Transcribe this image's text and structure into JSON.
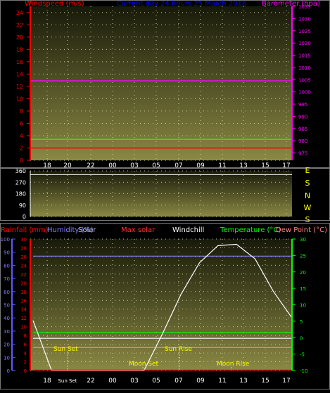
{
  "top": {
    "left_label": "Windspeed (m/s)",
    "center_label": "Current day 24 hours 25 March 2018",
    "right_label": "Barometer (hpa)",
    "colors": {
      "left": "#ff0000",
      "center": "#0000ff",
      "right": "#ff00ff"
    }
  },
  "middle": {
    "compass_labels": [
      "E",
      "S",
      "N",
      "W",
      "S"
    ]
  },
  "bottom": {
    "labels": {
      "rainfall": "Rainfall (mm)",
      "humidity": "Humidity (%)",
      "solar": "Solar",
      "max_solar": "Max solar",
      "windchill": "Windchill",
      "temperature": "Temperature (°C)",
      "dew_point": "Dew Point (°C)"
    },
    "annotations": {
      "sun_set": "Sun Set",
      "sun_rise": "Sun Rise",
      "moon_set": "Moon Set",
      "moon_rise": "Moon Rise"
    }
  },
  "chart_data": [
    {
      "type": "line",
      "title": "Current day 24 hours 25 March 2018",
      "x_tick_labels": [
        "18",
        "20",
        "22",
        "00",
        "03",
        "05",
        "07",
        "09",
        "11",
        "13",
        "15",
        "17"
      ],
      "left_axis": {
        "label": "Windspeed (m/s)",
        "ylim": [
          0,
          25
        ],
        "ticks": [
          0,
          2,
          4,
          6,
          8,
          10,
          12,
          14,
          16,
          18,
          20,
          22,
          24
        ]
      },
      "right_axis": {
        "label": "Barometer (hpa)",
        "ylim": [
          972,
          1035
        ],
        "ticks": [
          975,
          980,
          985,
          990,
          995,
          1000,
          1005,
          1010,
          1015,
          1020,
          1025,
          1030,
          1035
        ]
      },
      "series": [
        {
          "name": "Barometer (hpa)",
          "axis": "right",
          "color": "#ff00ff",
          "values": [
            1004.5,
            1004.5
          ]
        },
        {
          "name": "Windspeed (m/s)",
          "axis": "left",
          "color": "#00ff00",
          "values": [
            3.4,
            3.4
          ]
        },
        {
          "name": "Windspeed (m/s)",
          "axis": "left",
          "color": "#ff0000",
          "values": [
            2.0,
            2.0
          ]
        }
      ],
      "grid": true
    },
    {
      "type": "line",
      "ylim": [
        0,
        360
      ],
      "y_ticks": [
        0,
        90,
        180,
        270,
        360
      ],
      "series": [
        {
          "color": "#ffffff",
          "values": [
            330,
            330
          ]
        }
      ],
      "grid": true
    },
    {
      "type": "line",
      "x_tick_labels": [
        "18",
        "Sun Set",
        "22",
        "00",
        "03",
        "05",
        "07",
        "09",
        "11",
        "13",
        "15",
        "17"
      ],
      "axes": {
        "humidity": {
          "label": "Humidity (%)",
          "ylim": [
            0,
            100
          ],
          "ticks": [
            0,
            10,
            20,
            30,
            40,
            50,
            60,
            70,
            80,
            90,
            100
          ]
        },
        "rainfall": {
          "label": "Rainfall (mm)",
          "ylim": [
            0,
            30
          ],
          "ticks": [
            0,
            2,
            4,
            6,
            8,
            10,
            12,
            14,
            16,
            18,
            20,
            22,
            24,
            26,
            28,
            30
          ]
        },
        "temperature": {
          "label": "Temperature (°C)",
          "ylim": [
            -10,
            30
          ],
          "ticks": [
            -10,
            -5,
            0,
            5,
            10,
            15,
            20,
            25,
            30
          ]
        }
      },
      "series": [
        {
          "name": "Humidity (%)",
          "axis": "humidity",
          "color": "#8080ff",
          "values": [
            87,
            87
          ]
        },
        {
          "name": "Temperature (°C)",
          "axis": "temperature",
          "color": "#00ff00",
          "values": [
            1.5,
            1.5
          ]
        },
        {
          "name": "Dew Point (°C)",
          "axis": "temperature",
          "color": "#ff8080",
          "values": [
            -3,
            -3
          ]
        },
        {
          "name": "Windchill",
          "axis": "temperature",
          "color": "#ffffff",
          "values": [
            -0.2,
            -0.2
          ]
        },
        {
          "name": "Max solar",
          "color": "#ffffff",
          "values": [
            0.38,
            0,
            0,
            0,
            0,
            0,
            0,
            0.28,
            0.58,
            0.82,
            0.95,
            0.96,
            0.85,
            0.6,
            0.4
          ]
        },
        {
          "name": "Rainfall (mm)",
          "axis": "rainfall",
          "color": "#ff0000",
          "values": [
            0.1,
            0.1
          ]
        }
      ],
      "grid": true
    }
  ]
}
